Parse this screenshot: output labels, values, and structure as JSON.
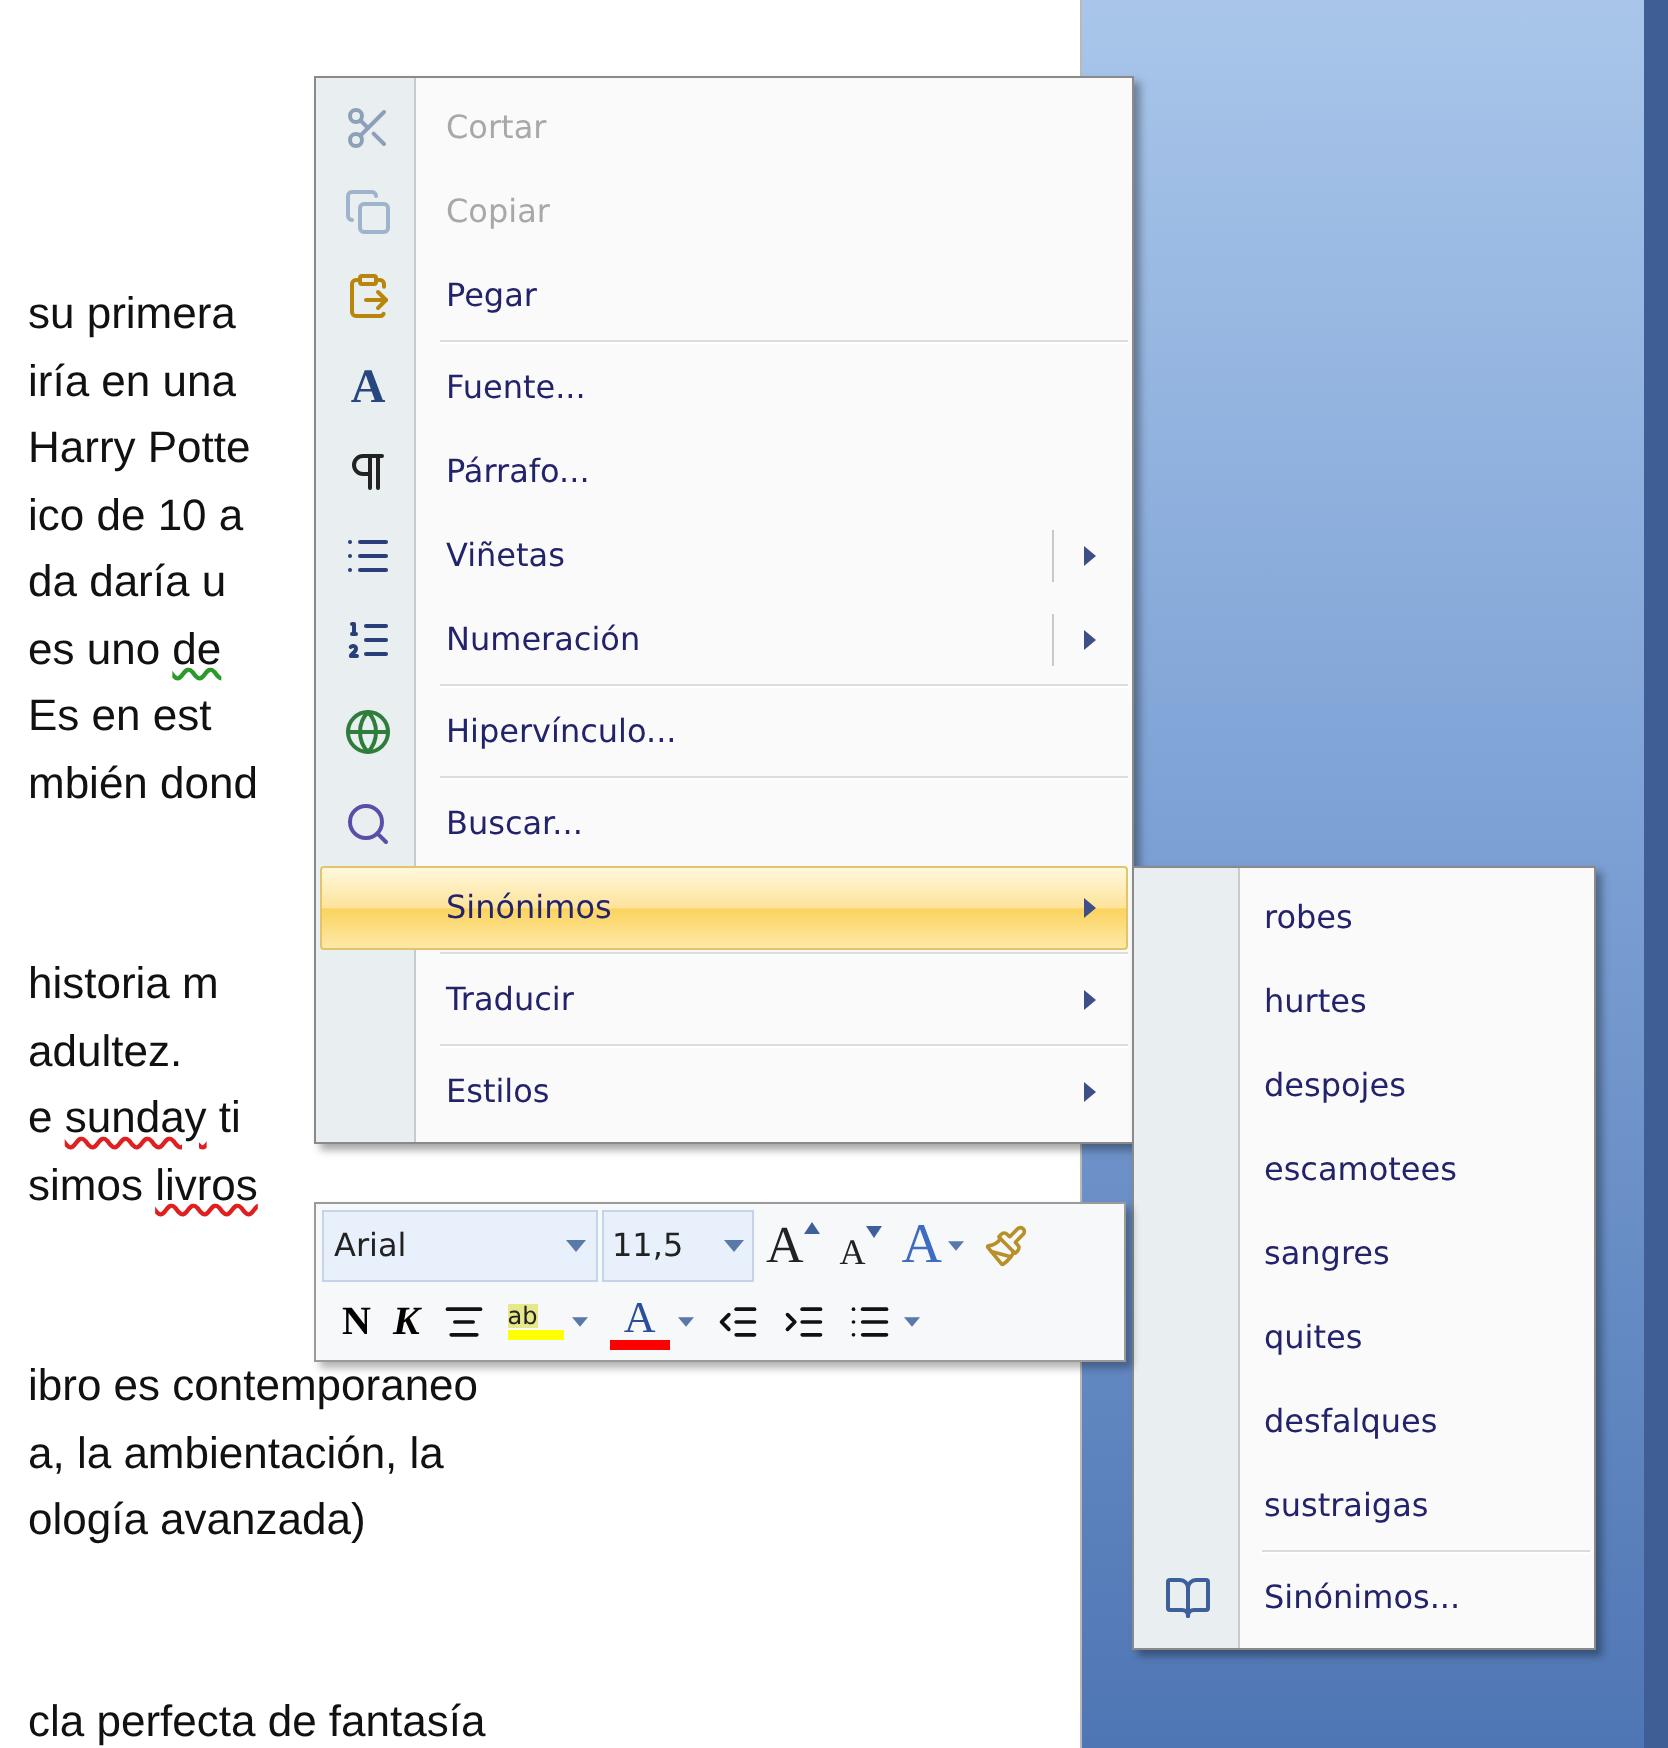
{
  "document": {
    "paragraphs": [
      {
        "lines": [
          {
            "segments": [
              {
                "text": "su primera"
              }
            ]
          },
          {
            "segments": [
              {
                "text": "iría en una"
              }
            ]
          },
          {
            "segments": [
              {
                "text": "Harry Potte"
              }
            ]
          },
          {
            "segments": [
              {
                "text": "ico de 10 a"
              }
            ]
          },
          {
            "segments": [
              {
                "text": "da daría u"
              }
            ]
          },
          {
            "segments": [
              {
                "text": "es uno "
              },
              {
                "text": "de",
                "grammar_error": true
              }
            ]
          },
          {
            "segments": [
              {
                "text": "Es en est"
              }
            ]
          },
          {
            "segments": [
              {
                "text": "mbién dond"
              }
            ]
          }
        ]
      },
      {
        "lines": [
          {
            "segments": [
              {
                "text": "historia m"
              }
            ]
          },
          {
            "segments": [
              {
                "text": "adultez."
              }
            ]
          },
          {
            "segments": [
              {
                "text": "e "
              },
              {
                "text": "sunday",
                "spelling_error": true
              },
              {
                "text": " ti"
              }
            ]
          },
          {
            "segments": [
              {
                "text": "simos "
              },
              {
                "text": "livros",
                "spelling_error": true
              }
            ]
          }
        ]
      },
      {
        "lines": [
          {
            "segments": [
              {
                "text": "ibro es contemporaneo"
              }
            ]
          },
          {
            "segments": [
              {
                "text": "a, la ambientación, la"
              }
            ]
          },
          {
            "segments": [
              {
                "text": "ología avanzada)"
              }
            ]
          }
        ]
      },
      {
        "lines": [
          {
            "segments": [
              {
                "text": "cla perfecta de fantasía"
              }
            ]
          }
        ]
      }
    ]
  },
  "context_menu": {
    "items": [
      {
        "kind": "item",
        "label": "Cortar",
        "disabled": true,
        "selected": false,
        "has_submenu": false,
        "split": false
      },
      {
        "kind": "item",
        "label": "Copiar",
        "disabled": true,
        "selected": false,
        "has_submenu": false,
        "split": false
      },
      {
        "kind": "item",
        "label": "Pegar",
        "disabled": false,
        "selected": false,
        "has_submenu": false,
        "split": false
      },
      {
        "kind": "separator"
      },
      {
        "kind": "item",
        "icon_text": "A",
        "label": "Fuente...",
        "disabled": false,
        "selected": false,
        "has_submenu": false,
        "split": false
      },
      {
        "kind": "item",
        "label": "Párrafo...",
        "disabled": false,
        "selected": false,
        "has_submenu": false,
        "split": false
      },
      {
        "kind": "item",
        "label": "Viñetas",
        "disabled": false,
        "selected": false,
        "has_submenu": true,
        "split": true
      },
      {
        "kind": "item",
        "label": "Numeración",
        "disabled": false,
        "selected": false,
        "has_submenu": true,
        "split": true
      },
      {
        "kind": "separator"
      },
      {
        "kind": "item",
        "label": "Hipervínculo...",
        "disabled": false,
        "selected": false,
        "has_submenu": false,
        "split": false
      },
      {
        "kind": "separator"
      },
      {
        "kind": "item",
        "label": "Buscar...",
        "disabled": false,
        "selected": false,
        "has_submenu": false,
        "split": false
      },
      {
        "kind": "item",
        "label": "Sinónimos",
        "disabled": false,
        "selected": true,
        "has_submenu": true,
        "split": false
      },
      {
        "kind": "separator"
      },
      {
        "kind": "item",
        "label": "Traducir",
        "disabled": false,
        "selected": false,
        "has_submenu": true,
        "split": false
      },
      {
        "kind": "separator"
      },
      {
        "kind": "item",
        "label": "Estilos",
        "disabled": false,
        "selected": false,
        "has_submenu": true,
        "split": false
      }
    ]
  },
  "synonyms_submenu": {
    "items": [
      {
        "kind": "item",
        "label": "robes"
      },
      {
        "kind": "item",
        "label": "hurtes"
      },
      {
        "kind": "item",
        "label": "despojes"
      },
      {
        "kind": "item",
        "label": "escamotees"
      },
      {
        "kind": "item",
        "label": "sangres"
      },
      {
        "kind": "item",
        "label": "quites"
      },
      {
        "kind": "item",
        "label": "desfalques"
      },
      {
        "kind": "item",
        "label": "sustraigas"
      },
      {
        "kind": "separator"
      },
      {
        "kind": "item",
        "label": "Sinónimos..."
      }
    ]
  },
  "mini_toolbar": {
    "font_field": {
      "value": "Arial"
    },
    "size_field": {
      "value": "11,5"
    },
    "row1": [
      {
        "kind": "grow",
        "text": "A"
      },
      {
        "kind": "shrink",
        "text": "A"
      },
      {
        "kind": "styles",
        "text": "A"
      },
      {
        "kind": "painter"
      }
    ],
    "row2": [
      {
        "kind": "bold",
        "text": "N"
      },
      {
        "kind": "italic",
        "text": "K"
      },
      {
        "kind": "center"
      },
      {
        "kind": "highlight",
        "text": "ab",
        "color": "#ffff00"
      },
      {
        "kind": "font_color",
        "text": "A",
        "color": "#ff0000"
      },
      {
        "kind": "outdent"
      },
      {
        "kind": "indent"
      },
      {
        "kind": "bullets"
      }
    ]
  }
}
